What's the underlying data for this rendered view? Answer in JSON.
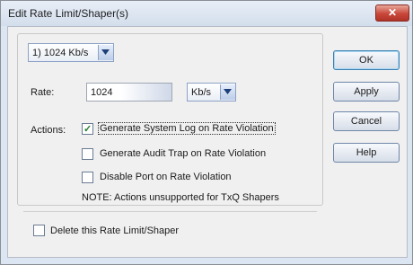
{
  "window": {
    "title": "Edit Rate Limit/Shaper(s)",
    "close_glyph": "✕"
  },
  "rate_selector": {
    "value": "1) 1024 Kb/s"
  },
  "rate": {
    "label": "Rate:",
    "value": "1024",
    "unit": "Kb/s"
  },
  "actions": {
    "label": "Actions:",
    "items": [
      {
        "label": "Generate System Log on Rate Violation",
        "checked": true
      },
      {
        "label": "Generate Audit Trap on Rate Violation",
        "checked": false
      },
      {
        "label": "Disable Port on Rate Violation",
        "checked": false
      }
    ],
    "note": "NOTE: Actions unsupported for TxQ Shapers"
  },
  "delete_option": {
    "label": "Delete this Rate Limit/Shaper",
    "checked": false
  },
  "buttons": {
    "ok": "OK",
    "apply": "Apply",
    "cancel": "Cancel",
    "help": "Help"
  },
  "colors": {
    "check": "#1f7d2b",
    "close_button": "#c9473a",
    "title_bar": "#dce6f2"
  }
}
